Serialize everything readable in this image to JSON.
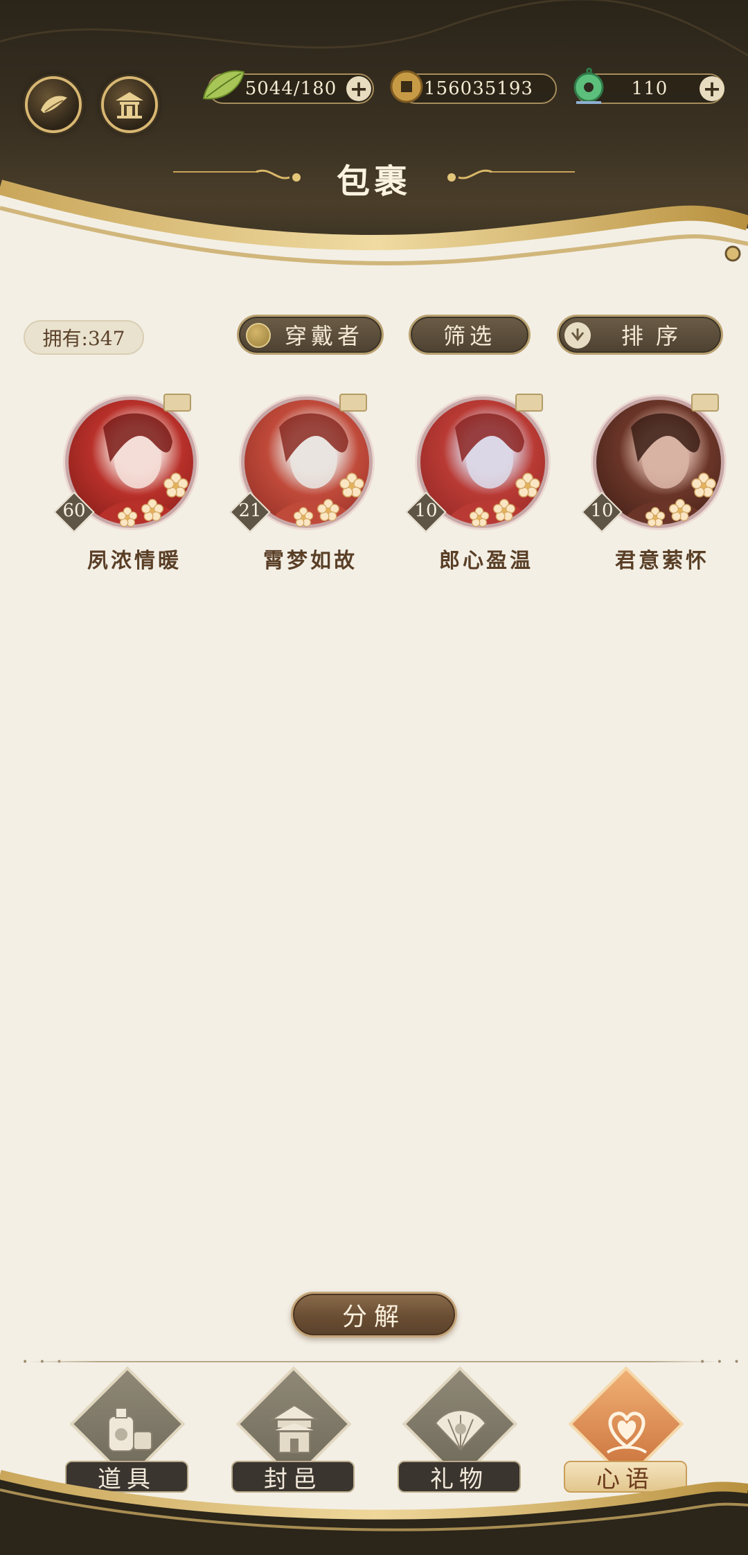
{
  "header": {
    "title": "包裹",
    "left_buttons": [
      {
        "icon": "crane-feather-icon"
      },
      {
        "icon": "pavilion-icon"
      }
    ],
    "resources": [
      {
        "icon": "green-leaf-icon",
        "value": "5044/180",
        "has_plus": true
      },
      {
        "icon": "copper-coin-icon",
        "value": "156035193",
        "has_plus": false
      },
      {
        "icon": "jade-pendant-icon",
        "value": "110",
        "has_plus": true
      }
    ]
  },
  "toolbar": {
    "own_count": "拥有:347",
    "wearer_label": "穿戴者",
    "filter_label": "筛选",
    "sort_label": "排序"
  },
  "cards": [
    {
      "name": "夙浓情暖",
      "level": "60",
      "palette": [
        "#b8302a",
        "#f4ddd6",
        "#7a1a16"
      ]
    },
    {
      "name": "霄梦如故",
      "level": "21",
      "palette": [
        "#c04a3a",
        "#e9e3df",
        "#8a2a22"
      ]
    },
    {
      "name": "郎心盈温",
      "level": "10",
      "palette": [
        "#b93a34",
        "#dcd7e6",
        "#8b2422"
      ]
    },
    {
      "name": "君意萦怀",
      "level": "10",
      "palette": [
        "#6a3528",
        "#d8b2a4",
        "#3a1c14"
      ]
    }
  ],
  "actions": {
    "decompose_label": "分解"
  },
  "tabs": [
    {
      "label": "道具",
      "icon": "items-icon",
      "active": false
    },
    {
      "label": "封邑",
      "icon": "fief-tower-icon",
      "active": false
    },
    {
      "label": "礼物",
      "icon": "gift-fan-icon",
      "active": false
    },
    {
      "label": "心语",
      "icon": "heart-knot-icon",
      "active": true
    }
  ],
  "colors": {
    "banner_dark": "#2a2419",
    "gold": "#d8b772",
    "paper": "#f3efe5",
    "active_tab": "#d8854a"
  }
}
